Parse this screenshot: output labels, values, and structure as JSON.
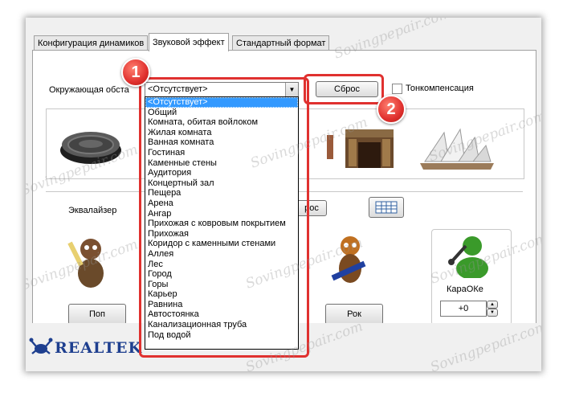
{
  "tabs": [
    {
      "label": "Конфигурация динамиков"
    },
    {
      "label": "Звуковой эффект"
    },
    {
      "label": "Стандартный формат"
    }
  ],
  "environment": {
    "label": "Окружающая обста",
    "selected": "<Отсутствует>",
    "options": [
      "<Отсутствует>",
      "Общий",
      "Комната, обитая войлоком",
      "Жилая комната",
      "Ванная комната",
      "Гостиная",
      "Каменные стены",
      "Аудитория",
      "Концертный зал",
      "Пещера",
      "Арена",
      "Ангар",
      "Прихожая с ковровым покрытием",
      "Прихожая",
      "Коридор с каменными стенами",
      "Аллея",
      "Лес",
      "Город",
      "Горы",
      "Карьер",
      "Равнина",
      "Автостоянка",
      "Канализационная труба",
      "Под водой"
    ]
  },
  "reset_button": "Сброс",
  "loudness_label": "Тонкомпенсация",
  "equalizer_label": "Эквалайзер",
  "equalizer_reset_partial": "рос",
  "pop_button": "Поп",
  "rock_button": "Рок",
  "karaoke": {
    "label": "КараОКе",
    "value": "+0"
  },
  "brand": "REALTEK",
  "badges": [
    "1",
    "2"
  ],
  "watermark": "Sovingpepair.com",
  "colors": {
    "highlight_red": "#e0312f",
    "selection_blue": "#3399ff",
    "realtek_blue": "#1e3f8f"
  }
}
